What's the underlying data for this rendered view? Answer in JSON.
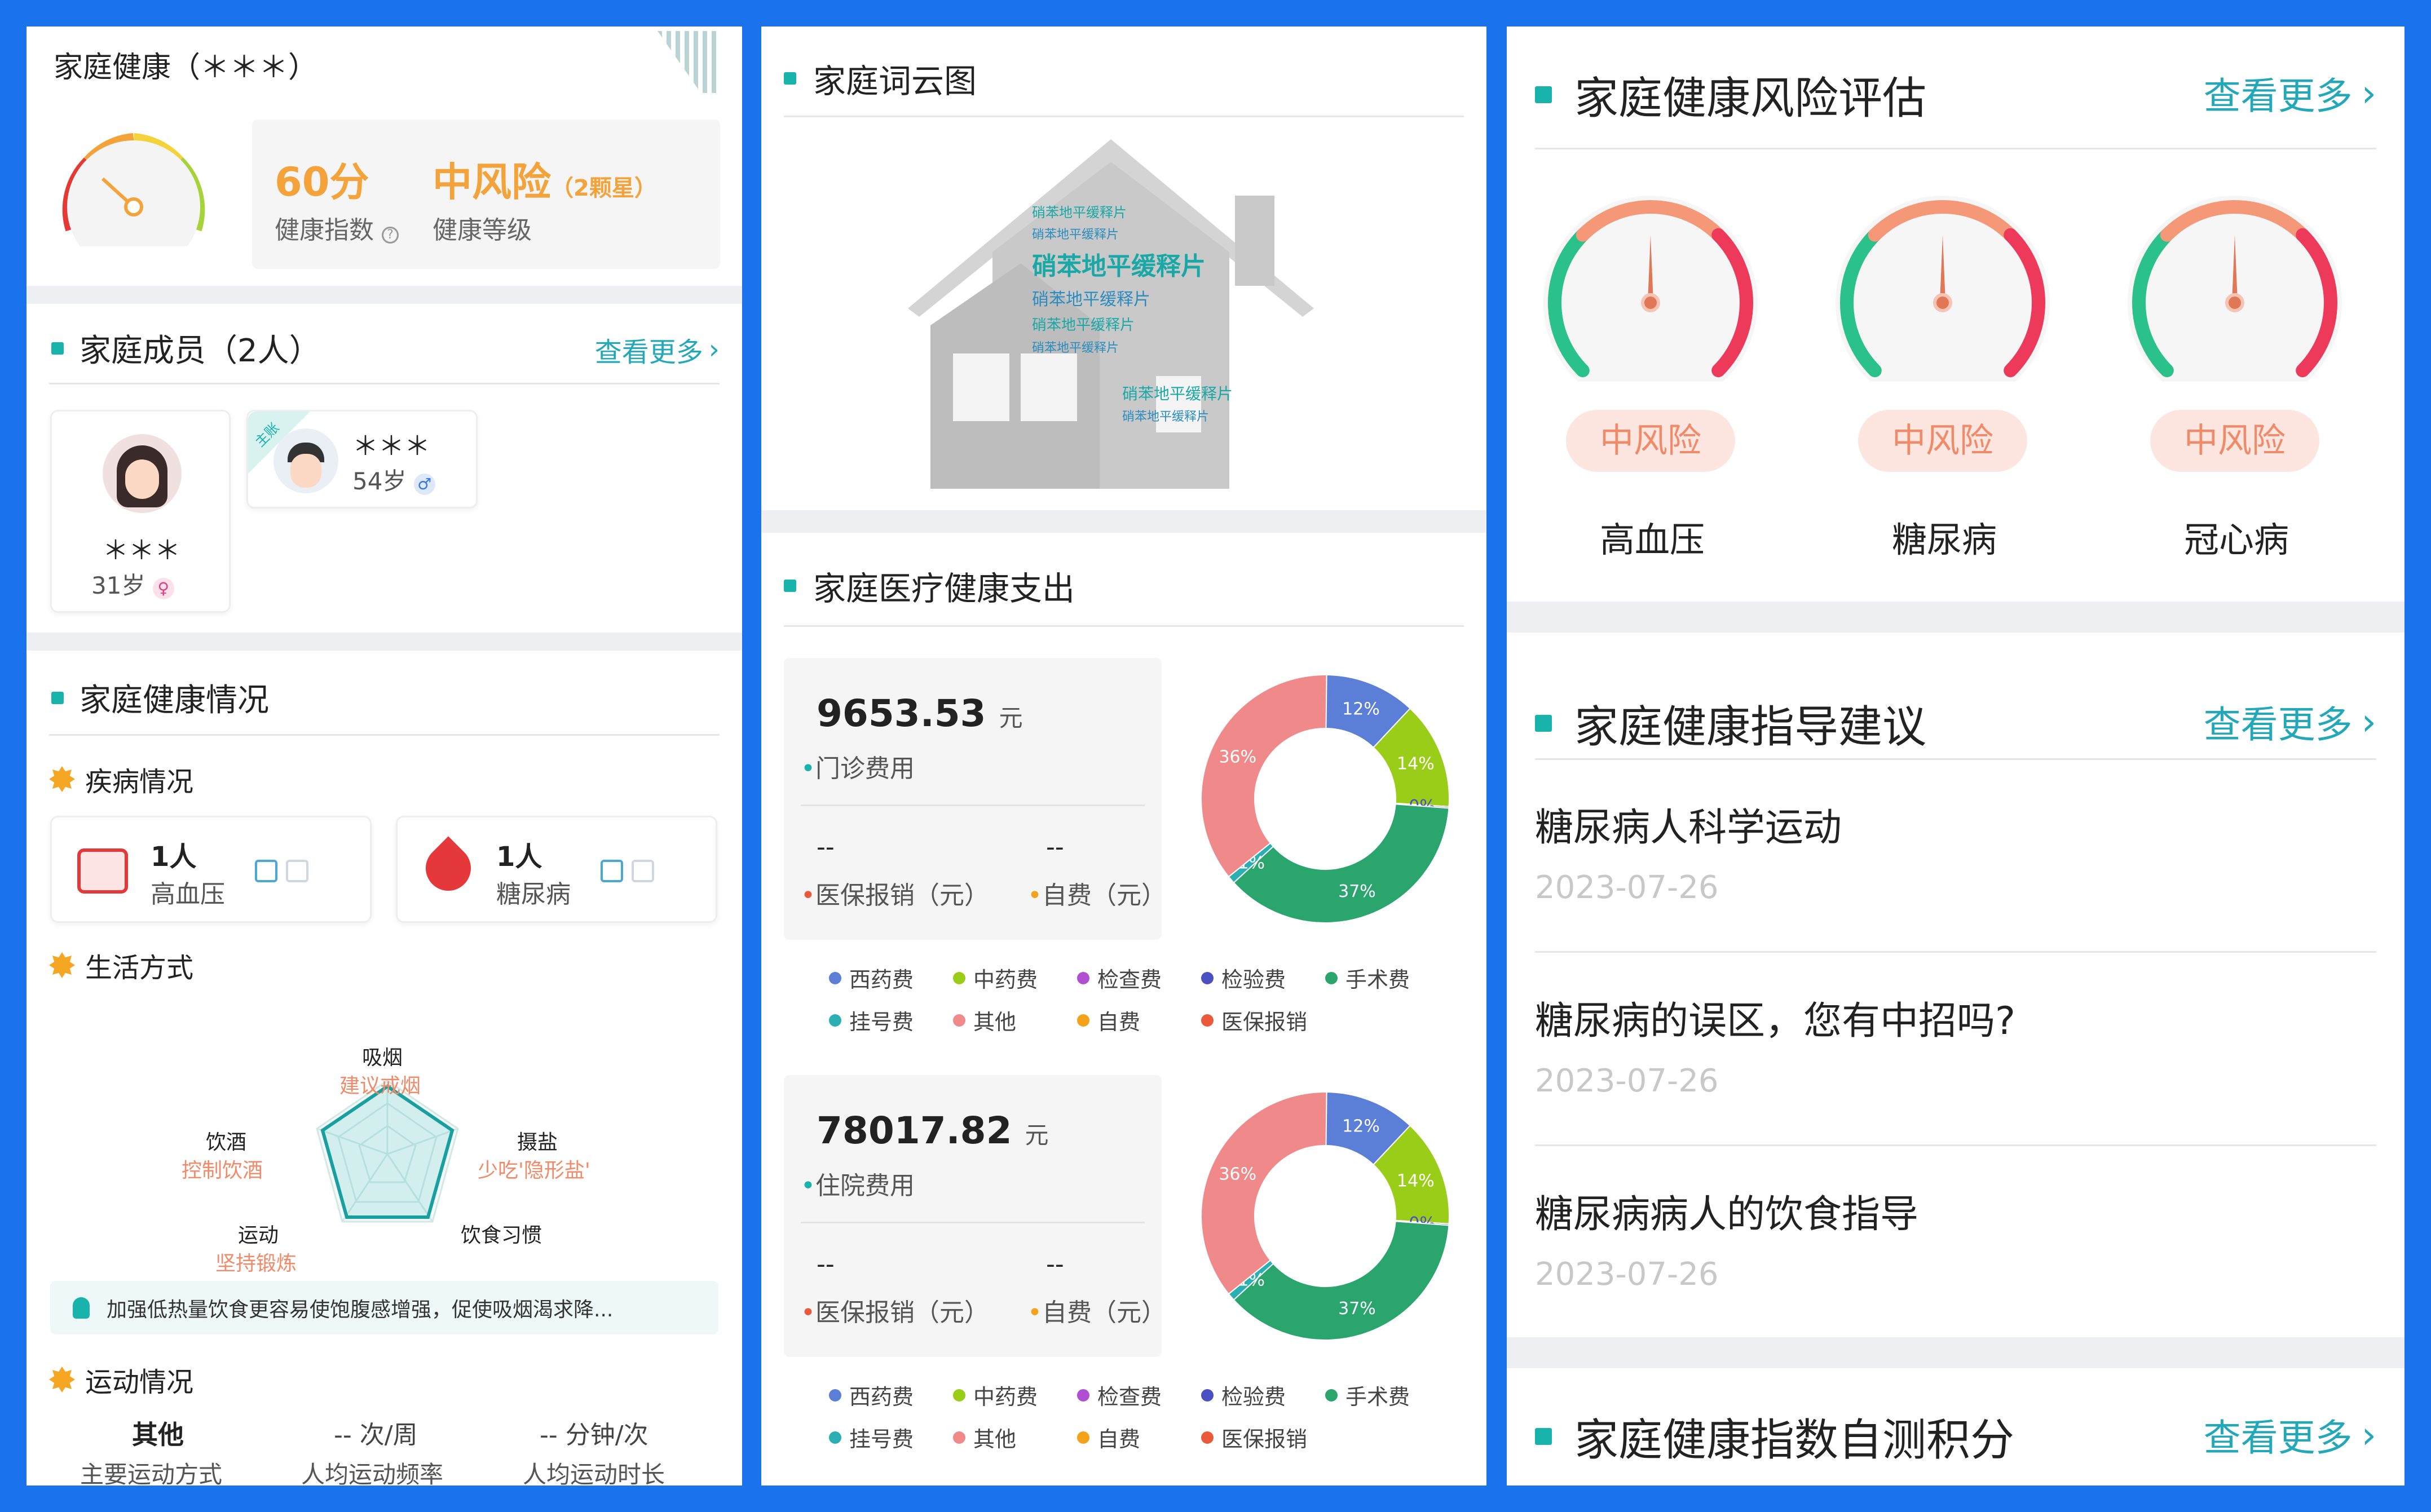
{
  "colors": {
    "frame": "#1a73ec",
    "accent": "#18b3aa",
    "link": "#22a8b8",
    "orange": "#f4a23a",
    "risk": "#f08a68"
  },
  "col1": {
    "title": "家庭健康（＊＊＊）",
    "score": "60分",
    "score_label": "健康指数",
    "level": "中风险",
    "level_sub": "（2颗星）",
    "level_label": "健康等级",
    "members": {
      "title": "家庭成员（2人）",
      "more": "查看更多",
      "m1": {
        "name": "＊＊＊",
        "age": "31岁",
        "icon": "female-icon"
      },
      "m2": {
        "name": "＊＊＊",
        "age": "54岁",
        "icon": "male-icon",
        "tag": "主账"
      }
    },
    "health": {
      "title": "家庭健康情况",
      "disease_title": "疾病情况",
      "d1": {
        "count": "1人",
        "name": "高血压",
        "icon": "blood-pressure-icon"
      },
      "d2": {
        "count": "1人",
        "name": "糖尿病",
        "icon": "blood-drop-icon"
      },
      "life_title": "生活方式",
      "radar": {
        "smoke": "吸烟",
        "smoke_tip": "建议戒烟",
        "salt": "摄盐",
        "salt_tip": "少吃'隐形盐'",
        "diet": "饮食习惯",
        "drink": "饮酒",
        "drink_tip": "控制饮酒",
        "sport": "运动",
        "sport_tip": "坚持锻炼"
      },
      "tip": "加强低热量饮食更容易使饱腹感增强，促使吸烟渴求降...",
      "sport_title": "运动情况",
      "s1": {
        "value": "其他",
        "label": "主要运动方式"
      },
      "s2": {
        "value": "-- 次/周",
        "label": "人均运动频率"
      },
      "s3": {
        "value": "-- 分钟/次",
        "label": "人均运动时长"
      }
    }
  },
  "col2": {
    "cloud_title": "家庭词云图",
    "cloud_words": [
      "硝苯地平缓释片",
      "硝苯地平缓释片",
      "硝苯地平缓释片",
      "硝苯地平缓释片",
      "硝苯地平缓释片",
      "硝苯地平缓释片",
      "硝苯地平缓释片",
      "硝苯地平缓释片"
    ],
    "expense_title": "家庭医疗健康支出",
    "b1": {
      "amount": "9653.53",
      "unit": "元",
      "label": "门诊费用",
      "v1": "--",
      "l1": "医保报销（元）",
      "v2": "--",
      "l2": "自费（元）"
    },
    "b2": {
      "amount": "78017.82",
      "unit": "元",
      "label": "住院费用",
      "v1": "--",
      "l1": "医保报销（元）",
      "v2": "--",
      "l2": "自费（元）"
    },
    "legend": [
      {
        "name": "西药费",
        "color": "#5b7fd6"
      },
      {
        "name": "中药费",
        "color": "#9acd17"
      },
      {
        "name": "检查费",
        "color": "#b04fd1"
      },
      {
        "name": "检验费",
        "color": "#4a4fc2"
      },
      {
        "name": "手术费",
        "color": "#2aa56e"
      },
      {
        "name": "挂号费",
        "color": "#2ab0b2"
      },
      {
        "name": "其他",
        "color": "#f08a8a"
      },
      {
        "name": "自费",
        "color": "#f4a21a"
      },
      {
        "name": "医保报销",
        "color": "#ea5a3a"
      }
    ]
  },
  "chart_data": [
    {
      "type": "pie",
      "title": "",
      "donut": true,
      "slices": [
        {
          "name": "西药费",
          "value": 12,
          "label": "12%"
        },
        {
          "name": "中药费",
          "value": 14,
          "label": "14%"
        },
        {
          "name": "检验费",
          "value": 0,
          "label": "0%"
        },
        {
          "name": "手术费",
          "value": 37,
          "label": "37%"
        },
        {
          "name": "挂号费",
          "value": 1,
          "label": "1%"
        },
        {
          "name": "其他",
          "value": 36,
          "label": "36%"
        }
      ]
    },
    {
      "type": "pie",
      "title": "",
      "donut": true,
      "slices": [
        {
          "name": "西药费",
          "value": 12,
          "label": "12%"
        },
        {
          "name": "中药费",
          "value": 14,
          "label": "14%"
        },
        {
          "name": "检验费",
          "value": 0,
          "label": "0%"
        },
        {
          "name": "手术费",
          "value": 37,
          "label": "37%"
        },
        {
          "name": "挂号费",
          "value": 1,
          "label": "1%"
        },
        {
          "name": "其他",
          "value": 36,
          "label": "36%"
        }
      ]
    }
  ],
  "col3": {
    "risk_title": "家庭健康风险评估",
    "more": "查看更多",
    "g1": {
      "level": "中风险",
      "name": "高血压"
    },
    "g2": {
      "level": "中风险",
      "name": "糖尿病"
    },
    "g3": {
      "level": "中风险",
      "name": "冠心病"
    },
    "guide_title": "家庭健康指导建议",
    "a1": {
      "title": "糖尿病人科学运动",
      "date": "2023-07-26"
    },
    "a2": {
      "title": "糖尿病的误区，您有中招吗?",
      "date": "2023-07-26"
    },
    "a3": {
      "title": "糖尿病病人的饮食指导",
      "date": "2023-07-26"
    },
    "score_title": "家庭健康指数自测积分"
  }
}
